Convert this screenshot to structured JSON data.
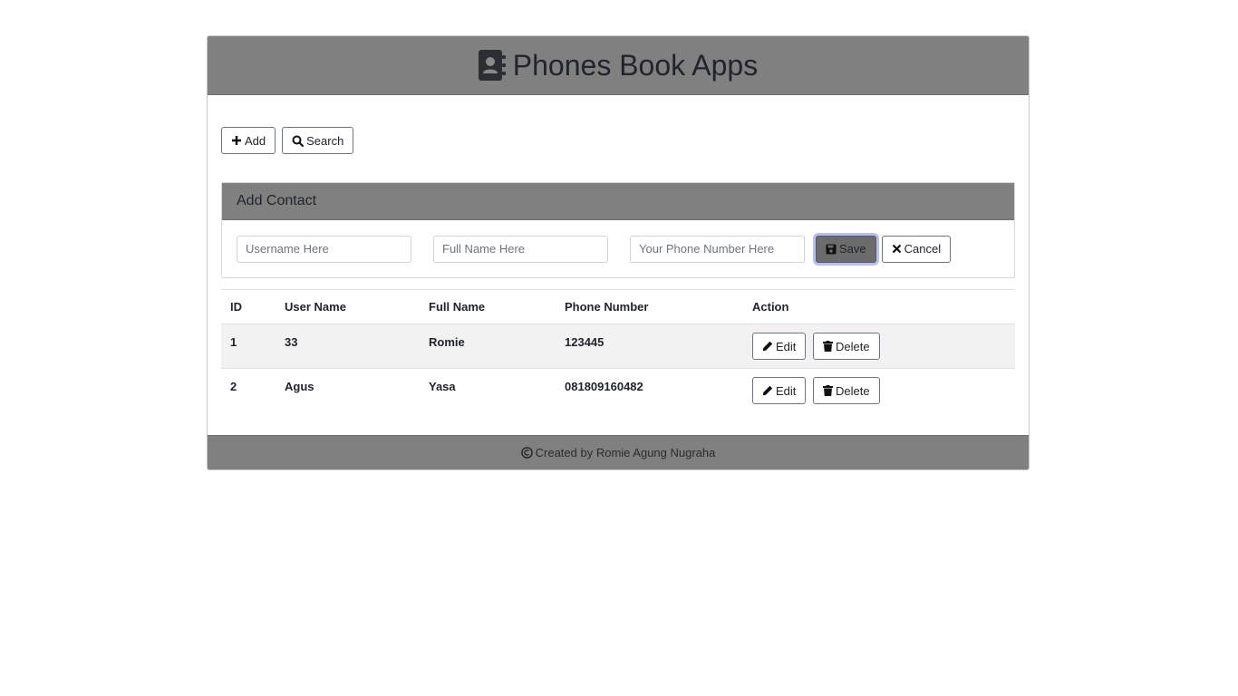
{
  "header": {
    "title": "Phones Book Apps",
    "icon": "address-book-icon"
  },
  "toolbar": {
    "add_label": "Add",
    "search_label": "Search"
  },
  "add_contact": {
    "title": "Add Contact",
    "username_placeholder": "Username Here",
    "fullname_placeholder": "Full Name Here",
    "phone_placeholder": "Your Phone Number Here",
    "save_label": "Save",
    "cancel_label": "Cancel"
  },
  "table": {
    "columns": [
      "ID",
      "User Name",
      "Full Name",
      "Phone Number",
      "Action"
    ],
    "rows": [
      {
        "id": "1",
        "username": "33",
        "fullname": "Romie",
        "phone": "123445"
      },
      {
        "id": "2",
        "username": "Agus",
        "fullname": "Yasa",
        "phone": "081809160482"
      }
    ],
    "edit_label": "Edit",
    "delete_label": "Delete"
  },
  "footer": {
    "text": "Created by Romie Agung Nugraha"
  },
  "colors": {
    "header_bg": "#808080",
    "save_button_bg": "#6c6c6c",
    "stripe_bg": "#f2f2f2"
  }
}
